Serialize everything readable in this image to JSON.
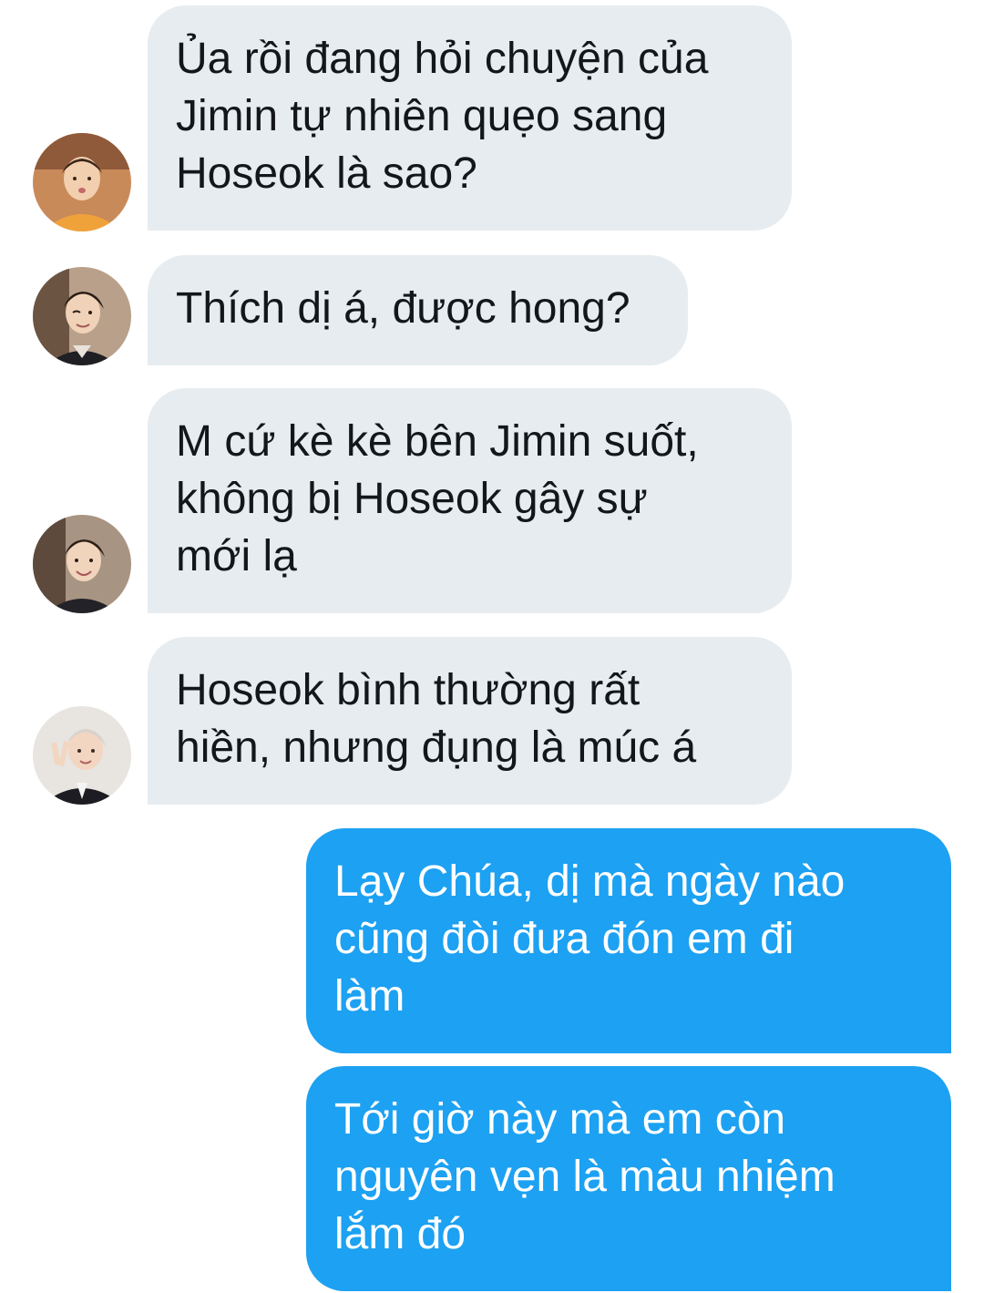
{
  "conversation": {
    "messages": [
      {
        "direction": "incoming",
        "avatar": "avatar-orange-shirt",
        "text": "Ủa rồi đang hỏi chuyện của\nJimin tự nhiên quẹo sang\nHoseok là sao?"
      },
      {
        "direction": "incoming",
        "avatar": "avatar-wink",
        "text": "Thích dị á, được hong?"
      },
      {
        "direction": "incoming",
        "avatar": "avatar-smile",
        "text": "M cứ kè kè bên Jimin suốt,\nkhông bị Hoseok gây sự\nmới lạ"
      },
      {
        "direction": "incoming",
        "avatar": "avatar-peace-sign",
        "text": "Hoseok bình thường rất\nhiền, nhưng đụng là múc á"
      },
      {
        "direction": "outgoing",
        "text": "Lạy Chúa, dị mà ngày nào\ncũng đòi đưa đón em đi\nlàm"
      },
      {
        "direction": "outgoing",
        "text": "Tới giờ này mà em còn\nnguyên vẹn là màu nhiệm\nlắm đó"
      }
    ]
  },
  "colors": {
    "incoming_bubble": "#e6ecf0",
    "outgoing_bubble": "#1da1f2",
    "incoming_text": "#14171a",
    "outgoing_text": "#ffffff"
  }
}
